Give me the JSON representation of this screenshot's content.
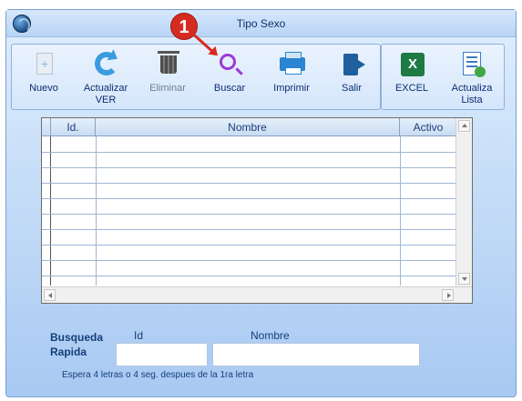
{
  "window": {
    "title": "Tipo Sexo"
  },
  "toolbar": {
    "nuevo": "Nuevo",
    "actualizar": "Actualizar\nVER",
    "eliminar": "Eliminar",
    "buscar": "Buscar",
    "imprimir": "Imprimir",
    "salir": "Salir",
    "excel": "EXCEL",
    "actualiza_lista": "Actualiza\nLista"
  },
  "annotation": {
    "badge_number": "1"
  },
  "grid": {
    "columns": [
      "Id.",
      "Nombre",
      "Activo"
    ],
    "rows": []
  },
  "quick_search": {
    "label": "Busqueda\nRapida",
    "id_label": "Id",
    "name_label": "Nombre",
    "id_value": "",
    "name_value": "",
    "hint": "Espera 4 letras o 4 seg. despues de la 1ra letra"
  },
  "colors": {
    "accent": "#d62b20",
    "label": "#143d7a"
  }
}
